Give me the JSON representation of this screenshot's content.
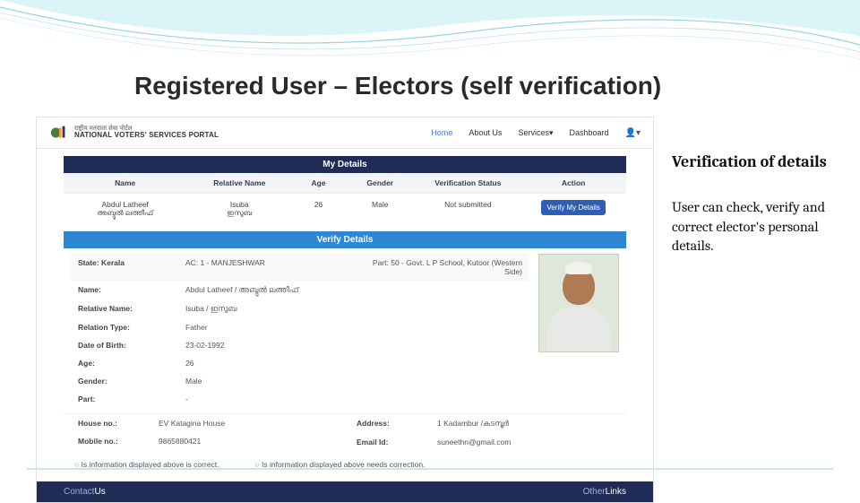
{
  "slide": {
    "title": "Registered User – Electors (self verification)"
  },
  "side": {
    "heading": "Verification of details",
    "body": "User can check, verify and correct elector's personal details."
  },
  "app": {
    "brand_line1": "राष्ट्रीय मतदाता सेवा पोर्टल",
    "brand_line2": "NATIONAL VOTERS' SERVICES PORTAL",
    "nav": {
      "home": "Home",
      "about": "About Us",
      "services": "Services",
      "dashboard": "Dashboard"
    },
    "panel1": {
      "title": "My Details",
      "headers": [
        "Name",
        "Relative Name",
        "Age",
        "Gender",
        "Verification Status",
        "Action"
      ],
      "row": {
        "name_en": "Abdul Latheef",
        "name_ml": "അബ്ദുൽ ലത്തീഫ്",
        "rel_en": "Isuba",
        "rel_ml": "ഇസുബ",
        "age": "26",
        "gender": "Male",
        "status": "Not submitted",
        "action": "Verify My Details"
      }
    },
    "panel2": {
      "title": "Verify Details",
      "state_label": "State: Kerala",
      "ac": "AC: 1 - MANJESHWAR",
      "part": "Part: 50 - Govt. L P School, Kutoor (Western Side)",
      "fields": {
        "name_l": "Name:",
        "name_v": "Abdul Latheef / അബ്ദുൽ ലത്തീഫ്",
        "rel_l": "Relative Name:",
        "rel_v": "Isuba / ഇസുബ",
        "reltype_l": "Relation Type:",
        "reltype_v": "Father",
        "dob_l": "Date of Birth:",
        "dob_v": "23-02-1992",
        "age_l": "Age:",
        "age_v": "26",
        "gender_l": "Gender:",
        "gender_v": "Male",
        "part_l": "Part:",
        "part_v": "-",
        "house_l": "House no.:",
        "house_v": "EV Katagina House",
        "addr_l": "Address:",
        "addr_v": "1   Kadambur /കടമ്പൂർ",
        "mob_l": "Mobile no.:",
        "mob_v": "9865880421",
        "email_l": "Email Id:",
        "email_v": "suneethn@gmail.com"
      },
      "radios": {
        "opt1": "Is information displayed above is correct.",
        "opt2": "Is information displayed above needs correction."
      }
    },
    "footer": {
      "contact1": "Contact",
      "contact2": "Us",
      "other1": "Other",
      "other2": "Links"
    }
  }
}
